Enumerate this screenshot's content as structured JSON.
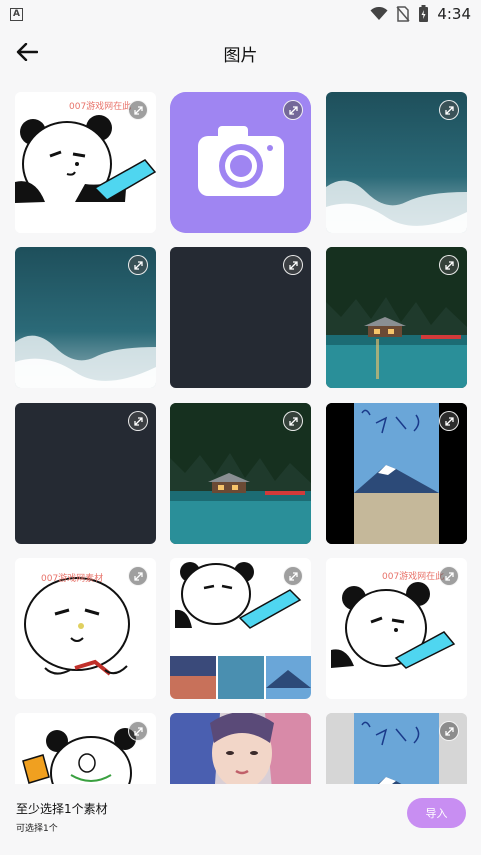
{
  "status_bar": {
    "time": "4:34",
    "indicator": "A"
  },
  "header": {
    "title": "图片",
    "back_icon": "arrow-left-icon"
  },
  "grid": {
    "tiles": [
      {
        "name": "panda-meme",
        "watermark": "007游戏网在此"
      },
      {
        "name": "camera-app-icon",
        "watermark": ""
      },
      {
        "name": "ocean-waves",
        "watermark": ""
      },
      {
        "name": "ocean-waves",
        "watermark": ""
      },
      {
        "name": "dark-blank",
        "watermark": ""
      },
      {
        "name": "lake-cabin",
        "watermark": ""
      },
      {
        "name": "dark-blank",
        "watermark": ""
      },
      {
        "name": "lake-cabin",
        "watermark": ""
      },
      {
        "name": "mountain-sketch",
        "watermark": ""
      },
      {
        "name": "bun-meme",
        "watermark": "007游戏网素材"
      },
      {
        "name": "panda-collage",
        "watermark": ""
      },
      {
        "name": "panda-meme",
        "watermark": "007游戏网在此"
      },
      {
        "name": "panda-bun-meme",
        "watermark": ""
      },
      {
        "name": "portrait-girl",
        "watermark": ""
      },
      {
        "name": "mountain-sketch",
        "watermark": ""
      }
    ]
  },
  "bottom": {
    "hint_main": "至少选择1个素材",
    "hint_sub": "可选择1个",
    "import_label": "导入"
  },
  "colors": {
    "accent": "#c88ef2",
    "camera_bg": "#9f85f2"
  }
}
